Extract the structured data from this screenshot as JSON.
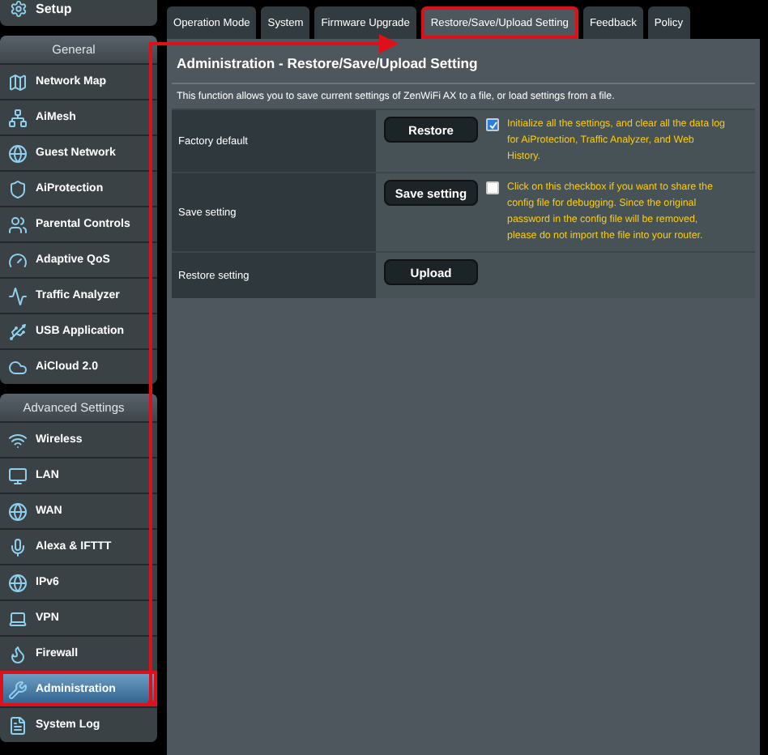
{
  "sidebar": {
    "top_item": {
      "label": "Setup"
    },
    "groups": [
      {
        "title": "General",
        "items": [
          {
            "label": "Network Map",
            "selected": false
          },
          {
            "label": "AiMesh",
            "selected": false
          },
          {
            "label": "Guest Network",
            "selected": false
          },
          {
            "label": "AiProtection",
            "selected": false
          },
          {
            "label": "Parental Controls",
            "selected": false
          },
          {
            "label": "Adaptive QoS",
            "selected": false
          },
          {
            "label": "Traffic Analyzer",
            "selected": false
          },
          {
            "label": "USB Application",
            "selected": false
          },
          {
            "label": "AiCloud 2.0",
            "selected": false
          }
        ]
      },
      {
        "title": "Advanced Settings",
        "items": [
          {
            "label": "Wireless",
            "selected": false
          },
          {
            "label": "LAN",
            "selected": false
          },
          {
            "label": "WAN",
            "selected": false
          },
          {
            "label": "Alexa & IFTTT",
            "selected": false
          },
          {
            "label": "IPv6",
            "selected": false
          },
          {
            "label": "VPN",
            "selected": false
          },
          {
            "label": "Firewall",
            "selected": false
          },
          {
            "label": "Administration",
            "selected": true
          },
          {
            "label": "System Log",
            "selected": false
          }
        ]
      }
    ]
  },
  "tabs": [
    {
      "label": "Operation Mode",
      "selected": false
    },
    {
      "label": "System",
      "selected": false
    },
    {
      "label": "Firmware Upgrade",
      "selected": false
    },
    {
      "label": "Restore/Save/Upload Setting",
      "selected": true
    },
    {
      "label": "Feedback",
      "selected": false
    },
    {
      "label": "Policy",
      "selected": false
    }
  ],
  "panel": {
    "title": "Administration - Restore/Save/Upload Setting",
    "description": "This function allows you to save current settings of ZenWiFi AX to a file, or load settings from a file.",
    "rows": [
      {
        "label": "Factory default",
        "button": "Restore",
        "checkbox": {
          "checked": true
        },
        "note": "Initialize all the settings, and clear all the data log for AiProtection, Traffic Analyzer, and Web History."
      },
      {
        "label": "Save setting",
        "button": "Save setting",
        "checkbox": {
          "checked": false
        },
        "note": "Click on this checkbox if you want to share the config file for debugging. Since the original password in the config file will be removed, please do not import the file into your router."
      },
      {
        "label": "Restore setting",
        "button": "Upload"
      }
    ]
  }
}
